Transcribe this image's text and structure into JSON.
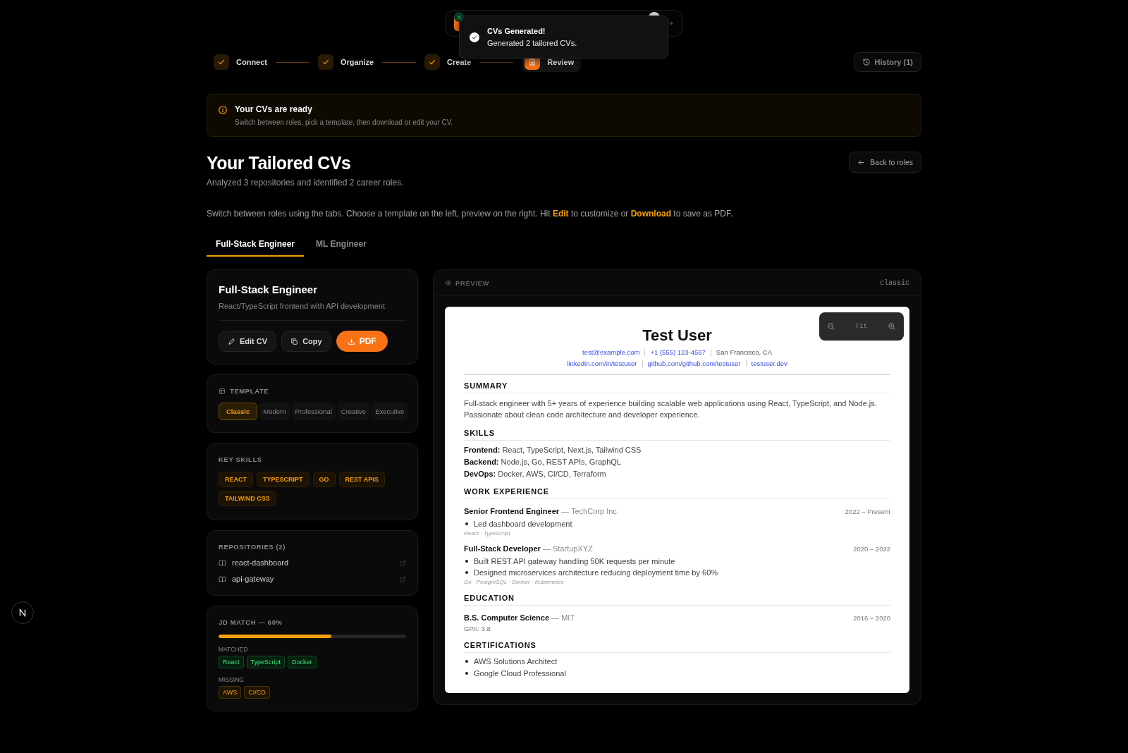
{
  "toast": {
    "title": "CVs Generated!",
    "message": "Generated 2 tailored CVs."
  },
  "stepper": [
    {
      "label": "Connect",
      "done": true,
      "selected": false
    },
    {
      "label": "Organize",
      "done": true,
      "selected": false
    },
    {
      "label": "Create",
      "done": true,
      "selected": false
    },
    {
      "label": "Review",
      "done": false,
      "selected": true
    }
  ],
  "history_button": {
    "label": "History (1)"
  },
  "banner": {
    "title": "Your CVs are ready",
    "text": "Switch between roles, pick a template, then download or edit your CV."
  },
  "page": {
    "title": "Your Tailored CVs",
    "subtitle": "Analyzed 3 repositories and identified 2 career roles.",
    "back_button": "Back to roles",
    "instructions": "Switch between roles using the tabs. Choose a template on the left, preview on the right. Hit **Edit** to customize or **Download** to save as PDF."
  },
  "role_tabs": [
    {
      "label": "Full-Stack Engineer",
      "selected": true
    },
    {
      "label": "ML Engineer",
      "selected": false
    }
  ],
  "role_card": {
    "title": "Full-Stack Engineer",
    "description": "React/TypeScript frontend with API development",
    "actions": [
      {
        "label": "Edit CV",
        "kind": "edit"
      },
      {
        "label": "Copy",
        "kind": "copy"
      },
      {
        "label": "PDF",
        "kind": "pdf"
      }
    ]
  },
  "template": {
    "heading": "TEMPLATE",
    "options": [
      {
        "label": "Classic",
        "selected": true
      },
      {
        "label": "Modern",
        "selected": false
      },
      {
        "label": "Professional",
        "selected": false
      },
      {
        "label": "Creative",
        "selected": false
      },
      {
        "label": "Executive",
        "selected": false
      }
    ]
  },
  "key_skills": {
    "heading": "KEY SKILLS",
    "skills": [
      "REACT",
      "TYPESCRIPT",
      "GO",
      "REST APIS",
      "TAILWIND CSS"
    ]
  },
  "repositories": {
    "heading": "REPOSITORIES (2)",
    "items": [
      "react-dashboard",
      "api-gateway"
    ]
  },
  "jd_match": {
    "heading": "JD MATCH — 60%",
    "level": 0.6,
    "matched_label": "MATCHED",
    "matched": [
      "React",
      "TypeScript",
      "Docker"
    ],
    "missing_label": "MISSING",
    "missing": [
      "AWS",
      "CI/CD"
    ]
  },
  "preview": {
    "heading": "PREVIEW",
    "template_tag": "classic",
    "zoom_label": "Fit",
    "cv": {
      "name": "Test User",
      "contact_lines": [
        [
          {
            "text": "test@example.com",
            "kind": "link"
          },
          {
            "text": "+1 (555) 123-4567",
            "kind": "link"
          },
          {
            "text": "San Francisco, CA",
            "kind": "plain"
          }
        ],
        [
          {
            "text": "linkedin.com/in/testuser",
            "kind": "link"
          },
          {
            "text": "github.com/github.com/testuser",
            "kind": "link"
          },
          {
            "text": "testuser.dev",
            "kind": "link"
          }
        ]
      ],
      "sections": [
        {
          "heading": "SUMMARY",
          "kind": "text",
          "text": "Full-stack engineer with 5+ years of experience building scalable web applications using React, TypeScript, and Node.js. Passionate about clean code architecture and developer experience."
        },
        {
          "heading": "SKILLS",
          "kind": "skills",
          "lines": [
            "**Frontend:** React, TypeScript, Next.js, Tailwind CSS",
            "**Backend:** Node.js, Go, REST APIs, GraphQL",
            "**DevOps:** Docker, AWS, CI/CD, Terraform"
          ]
        },
        {
          "heading": "WORK EXPERIENCE",
          "kind": "entries",
          "entries": [
            {
              "title": "Senior Frontend Engineer",
              "org": "— TechCorp Inc.",
              "dates": "2022 – Present",
              "bullets": [
                "Led dashboard development"
              ],
              "tech": "React · TypeScript"
            },
            {
              "title": "Full-Stack Developer",
              "org": "— StartupXYZ",
              "dates": "2020 – 2022",
              "bullets": [
                "Built REST API gateway handling 50K requests per minute",
                "Designed microservices architecture reducing deployment time by 60%"
              ],
              "tech": "Go · PostgreSQL · Docker · Kubernetes"
            }
          ]
        },
        {
          "heading": "EDUCATION",
          "kind": "entries",
          "entries": [
            {
              "title": "B.S. Computer Science",
              "org": "— MIT",
              "dates": "2016 – 2020",
              "note": "GPA: 3.8"
            }
          ]
        },
        {
          "heading": "CERTIFICATIONS",
          "kind": "list",
          "items": [
            "AWS Solutions Architect",
            "Google Cloud Professional"
          ]
        }
      ]
    }
  }
}
